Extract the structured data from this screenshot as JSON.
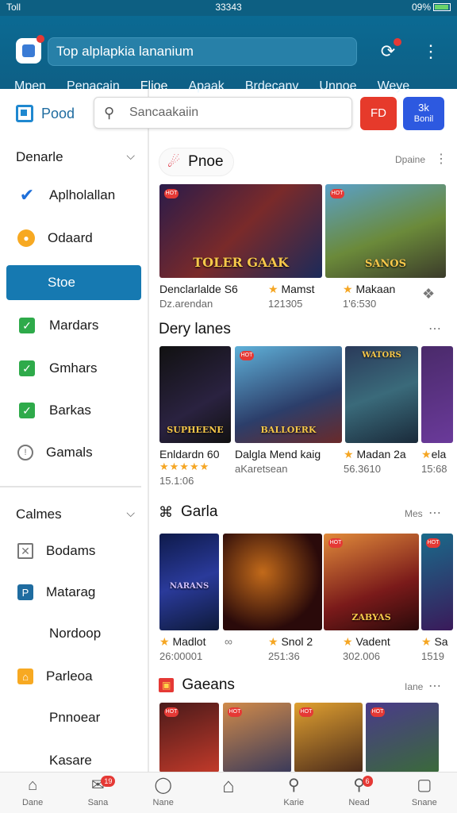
{
  "status": {
    "carrier": "Toll",
    "time": "33343",
    "battery": "09%"
  },
  "header": {
    "search_text": "Top alplapkia lananium",
    "tabs": [
      "Mpen",
      "Penacain",
      "Flioe",
      "Apaak",
      "Brdecanv",
      "Unnoe",
      "Weye"
    ],
    "active_tab": 2
  },
  "sidebar": {
    "brand": "Pood",
    "section1": "Denarle",
    "items1": [
      {
        "label": "Aplholallan",
        "icon": "checkmark-icon"
      },
      {
        "label": "Odaard",
        "icon": "gear-icon"
      },
      {
        "label": "Stoe",
        "icon": "none",
        "active": true
      },
      {
        "label": "Mardars",
        "icon": "check-box-icon"
      },
      {
        "label": "Gmhars",
        "icon": "check-box-icon"
      },
      {
        "label": "Barkas",
        "icon": "check-box-icon"
      },
      {
        "label": "Gamals",
        "icon": "chat-bubble-icon"
      }
    ],
    "section2": "Calmes",
    "items2": [
      {
        "label": "Bodams",
        "icon": "x-box-icon"
      },
      {
        "label": "Matarag",
        "icon": "p-box-icon"
      },
      {
        "label": "Nordoop",
        "icon": "none"
      },
      {
        "label": "Parleoa",
        "icon": "home-box-icon"
      },
      {
        "label": "Pnnoear",
        "icon": "none"
      },
      {
        "label": "Kasare",
        "icon": "none"
      }
    ]
  },
  "search": {
    "placeholder": "Sancaakaiin",
    "red_btn": "FD",
    "blue_btn_top": "3k",
    "blue_btn_bottom": "Bonil"
  },
  "sections": {
    "s1": {
      "title": "Pnoe",
      "more": "Dpaine"
    },
    "s2": {
      "title": "Dery lanes"
    },
    "s3": {
      "title": "Garla",
      "more": "Mes"
    },
    "s4": {
      "title": "Gaeans",
      "more": "Iane"
    }
  },
  "row1": [
    {
      "art": "TOLER GAAK",
      "title": "Denclarlalde S6",
      "sub": "Dz.arendan"
    },
    {
      "art": "SANOS",
      "title": "Mamst",
      "sub": "121305"
    },
    {
      "art": "",
      "title": "Makaan",
      "sub": "1'6:530"
    }
  ],
  "row2": [
    {
      "art": "SUPHEENE",
      "title": "Enldardn 60",
      "sub": "15.1:06"
    },
    {
      "art": "BALLOERK",
      "title": "Dalgla Mend kaig",
      "sub": "aKaretsean"
    },
    {
      "art": "WATORS",
      "title": "Madan 2a",
      "sub": "56.3610"
    },
    {
      "art": "",
      "title": "ela",
      "sub": "15:68"
    }
  ],
  "row3": [
    {
      "art": "NARANS",
      "title": "Madlot",
      "sub": "26:00001"
    },
    {
      "art": "",
      "title": "",
      "sub": ""
    },
    {
      "art": "",
      "title": "Snol 2",
      "sub": "251:36"
    },
    {
      "art": "ZABYAS",
      "title": "Vadent",
      "sub": "302.006"
    },
    {
      "art": "",
      "title": "Sa",
      "sub": "1519"
    }
  ],
  "bottom_nav": [
    {
      "label": "Dane",
      "icon": "home-icon"
    },
    {
      "label": "Sana",
      "icon": "chat-icon",
      "badge": "19"
    },
    {
      "label": "Nane",
      "icon": "controller-icon"
    },
    {
      "label": "",
      "icon": "house-icon"
    },
    {
      "label": "Karie",
      "icon": "search-icon"
    },
    {
      "label": "Nead",
      "icon": "notification-icon",
      "badge": "6"
    },
    {
      "label": "Snane",
      "icon": "square-icon"
    }
  ],
  "colors": {
    "header": "#0b6a93",
    "active": "#1679b1",
    "accent_red": "#e63a2b",
    "accent_blue": "#2d59e0"
  }
}
